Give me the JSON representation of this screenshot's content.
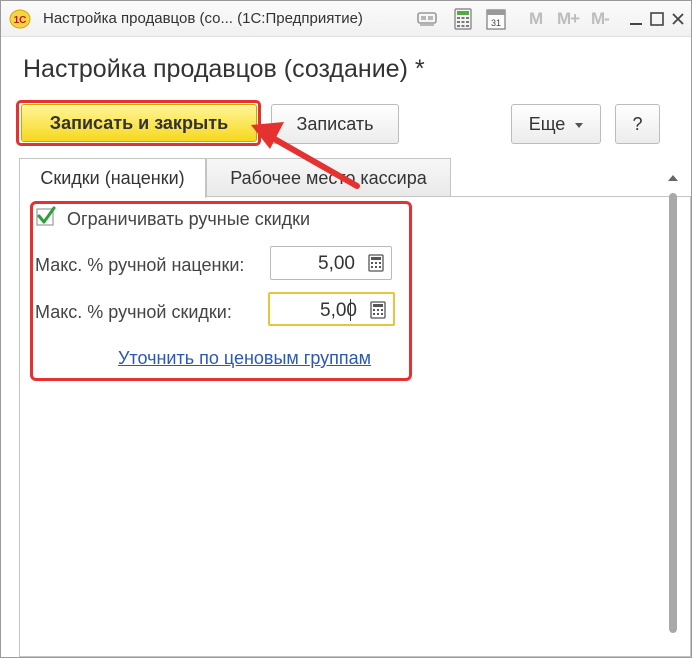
{
  "window": {
    "title": "Настройка продавцов (со...  (1С:Предприятие)",
    "app_logo_text": "1С",
    "m_buttons": [
      "M",
      "M+",
      "M-"
    ]
  },
  "form": {
    "heading": "Настройка продавцов (создание) *"
  },
  "toolbar": {
    "save_close_label": "Записать и закрыть",
    "save_label": "Записать",
    "more_label": "Еще",
    "help_label": "?"
  },
  "tabs": [
    {
      "label": "Скидки (наценки)",
      "active": true
    },
    {
      "label": "Рабочее место кассира",
      "active": false
    }
  ],
  "discounts": {
    "limit_manual_label": "Ограничивать ручные скидки",
    "limit_manual_checked": true,
    "max_markup_label": "Макс. % ручной наценки:",
    "max_markup_value": "5,00",
    "max_discount_label": "Макс. % ручной скидки:",
    "max_discount_value": "5,00",
    "price_groups_link": "Уточнить по ценовым группам"
  },
  "colors": {
    "accent_yellow": "#f7d81d",
    "annotation_red": "#e5312f",
    "link_blue": "#2a58b7",
    "check_green": "#2e9e3a"
  },
  "icons": {
    "app": "1c-logo-icon",
    "title_actions": [
      "link-icon",
      "calculator-icon",
      "calendar-icon"
    ],
    "window": [
      "minimize-icon",
      "maximize-icon",
      "close-icon"
    ],
    "field": "calculator-icon"
  }
}
